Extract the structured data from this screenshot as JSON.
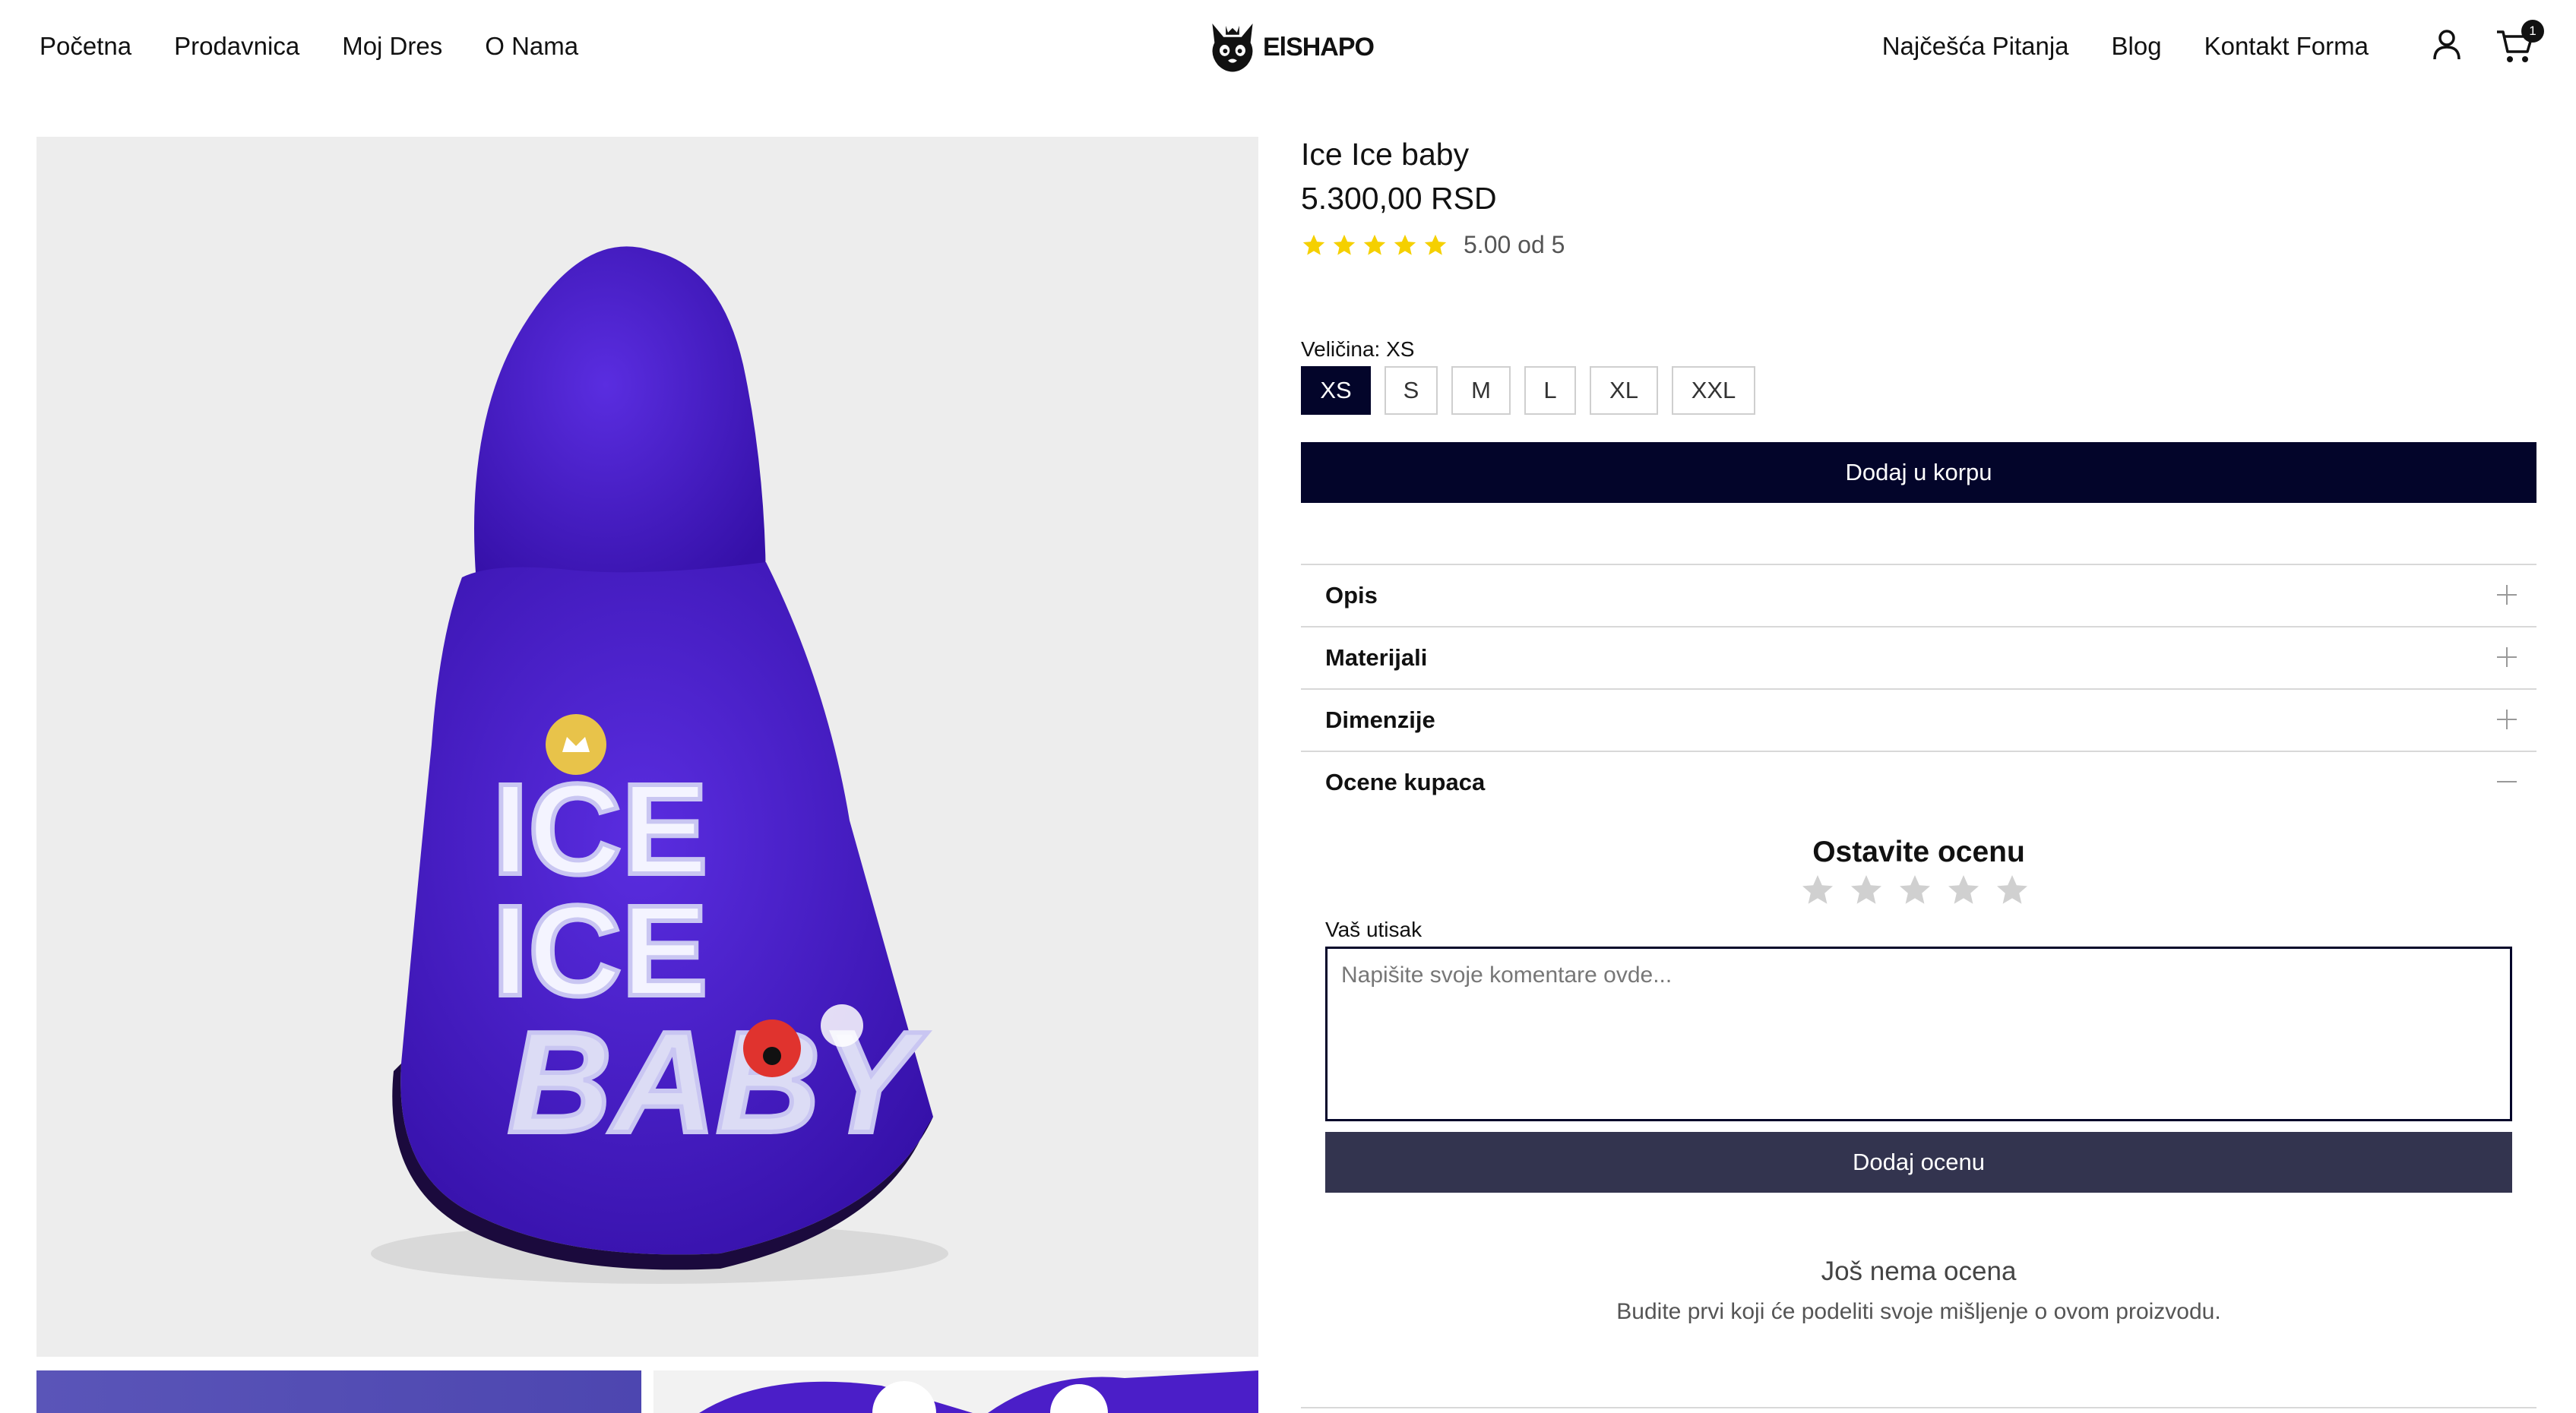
{
  "header": {
    "nav_left": [
      "Početna",
      "Prodavnica",
      "Moj Dres",
      "O Nama"
    ],
    "nav_right": [
      "Najčešća Pitanja",
      "Blog",
      "Kontakt Forma"
    ],
    "logo_text": "ElSHAPO",
    "cart_count": "1"
  },
  "product": {
    "title": "Ice Ice baby",
    "price": "5.300,00 RSD",
    "rating": {
      "stars": 5,
      "value": 5.0,
      "text": "5.00 od 5"
    },
    "size_label": "Veličina: XS",
    "sizes": [
      "XS",
      "S",
      "M",
      "L",
      "XL",
      "XXL"
    ],
    "selected_size": "XS",
    "add_to_cart": "Dodaj u korpu",
    "image": {
      "print_text": [
        "ICE",
        "ICE",
        "BABY"
      ]
    }
  },
  "accordion": {
    "items": [
      "Opis",
      "Materijali",
      "Dimenzije",
      "Ocene kupaca"
    ],
    "open_item": "Ocene kupaca"
  },
  "reviews": {
    "title": "Ostavite ocenu",
    "field_label": "Vaš utisak",
    "placeholder": "Napišite svoje komentare ovde...",
    "submit": "Dodaj ocenu",
    "empty_title": "Još nema ocena",
    "empty_subtitle": "Budite prvi koji će podeliti svoje mišljenje o ovom proizvodu."
  },
  "colors": {
    "primary_dark": "#03052a",
    "submit_button": "#33344f",
    "star_filled": "#f5d000",
    "star_empty": "#d0d0d0",
    "hoodie": "#4b1ec8"
  }
}
